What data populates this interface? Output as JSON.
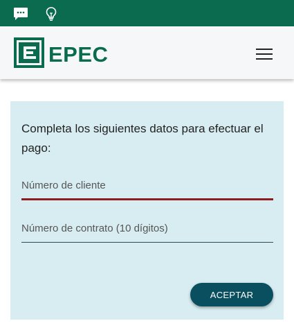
{
  "topbar": {
    "icons": [
      "chat-icon",
      "lightbulb-icon"
    ],
    "color": "#0b6b4f"
  },
  "header": {
    "logo_text": "EPEC",
    "menu_icon": "hamburger-menu-icon"
  },
  "form": {
    "instructions": "Completa los siguientes datos para efectuar el pago:",
    "client_number": {
      "placeholder": "Número de cliente",
      "value": ""
    },
    "contract_number": {
      "placeholder": "Número de contrato (10 dígitos)",
      "value": ""
    },
    "submit_label": "ACEPTAR"
  },
  "colors": {
    "brand_green": "#0b6b4f",
    "card_background": "#d8edf2",
    "active_underline": "#8e1c1f",
    "button": "#0a4f60"
  }
}
